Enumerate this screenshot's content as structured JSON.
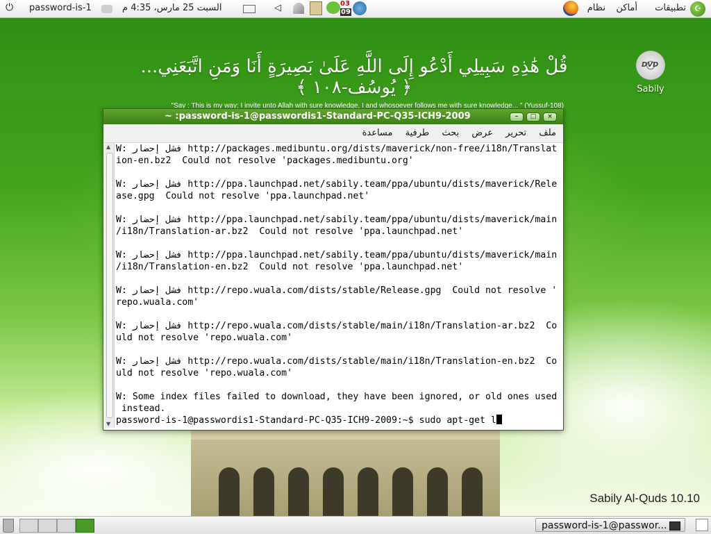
{
  "top_panel": {
    "menus": [
      "تطبيقات",
      "أماكن",
      "نظام"
    ],
    "datetime": "السبت 25 مارس، 4:35 م",
    "user": "password-is-1",
    "badge_top": "03",
    "badge_bottom": "09"
  },
  "desktop": {
    "verse": "قُلْ هَٰذِهِ سَبِيلِي أَدْعُو إِلَى اللَّهِ عَلَىٰ بَصِيرَةٍ أَنَا وَمَنِ اتَّبَعَنِي... ﴿ يُوسُف-١٠٨ ﴾",
    "verse_translation": "\"Say : This is my way; I invite unto Allah with sure knowledge, I and whosoever follows me with sure knowledge... \" (Yussuf-108)",
    "icon_label": "Sabily",
    "dvd_text": "DVD",
    "version": "Sabily Al-Quds 10.10"
  },
  "terminal": {
    "title": "~ :password-is-1@passwordis1-Standard-PC-Q35-ICH9-2009",
    "menu": [
      "ملف",
      "تحرير",
      "عرض",
      "بحث",
      "طرفية",
      "مساعدة"
    ],
    "lines": [
      "W: فشل إحضار http://packages.medibuntu.org/dists/maverick/non-free/i18n/Translat",
      "ion-en.bz2  Could not resolve 'packages.medibuntu.org'",
      "",
      "W: فشل إحضار http://ppa.launchpad.net/sabily.team/ppa/ubuntu/dists/maverick/Rele",
      "ase.gpg  Could not resolve 'ppa.launchpad.net'",
      "",
      "W: فشل إحضار http://ppa.launchpad.net/sabily.team/ppa/ubuntu/dists/maverick/main",
      "/i18n/Translation-ar.bz2  Could not resolve 'ppa.launchpad.net'",
      "",
      "W: فشل إحضار http://ppa.launchpad.net/sabily.team/ppa/ubuntu/dists/maverick/main",
      "/i18n/Translation-en.bz2  Could not resolve 'ppa.launchpad.net'",
      "",
      "W: فشل إحضار http://repo.wuala.com/dists/stable/Release.gpg  Could not resolve '",
      "repo.wuala.com'",
      "",
      "W: فشل إحضار http://repo.wuala.com/dists/stable/main/i18n/Translation-ar.bz2  Co",
      "uld not resolve 'repo.wuala.com'",
      "",
      "W: فشل إحضار http://repo.wuala.com/dists/stable/main/i18n/Translation-en.bz2  Co",
      "uld not resolve 'repo.wuala.com'",
      "",
      "W: Some index files failed to download, they have been ignored, or old ones used",
      " instead."
    ],
    "prompt": "password-is-1@passwordis1-Standard-PC-Q35-ICH9-2009:~$ sudo apt-get l"
  },
  "bottom_panel": {
    "task_label": "password-is-1@passwor..."
  },
  "colors": {
    "desktop_green": "#3a9a14",
    "titlebar_green": "#4a9a2a"
  }
}
